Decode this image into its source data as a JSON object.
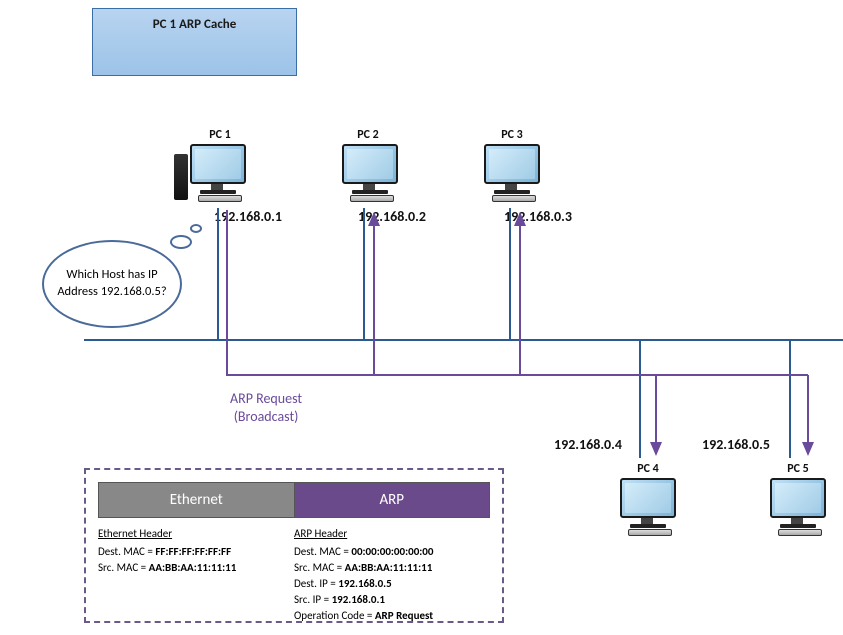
{
  "cache_title": "PC 1  ARP Cache",
  "bubble_text": "Which Host has IP Address 192.168.0.5?",
  "arp_request_label_1": "ARP Request",
  "arp_request_label_2": "(Broadcast)",
  "pcs": {
    "pc1": {
      "label": "PC 1",
      "ip": "192.168.0.1"
    },
    "pc2": {
      "label": "PC 2",
      "ip": "192.168.0.2"
    },
    "pc3": {
      "label": "PC 3",
      "ip": "192.168.0.3"
    },
    "pc4": {
      "label": "PC 4",
      "ip": "192.168.0.4"
    },
    "pc5": {
      "label": "PC 5",
      "ip": "192.168.0.5"
    }
  },
  "packet": {
    "eth_title": "Ethernet",
    "arp_title": "ARP",
    "eth_header_label": "Ethernet Header",
    "eth_dest_mac_label": "Dest. MAC = ",
    "eth_dest_mac": "FF:FF:FF:FF:FF:FF",
    "eth_src_mac_label": "Src. MAC = ",
    "eth_src_mac": "AA:BB:AA:11:11:11",
    "arp_header_label": "ARP Header",
    "arp_dest_mac_label": "Dest. MAC = ",
    "arp_dest_mac": "00:00:00:00:00:00",
    "arp_src_mac_label": "Src. MAC = ",
    "arp_src_mac": "AA:BB:AA:11:11:11",
    "arp_dest_ip_label": "Dest. IP = ",
    "arp_dest_ip": "192.168.0.5",
    "arp_src_ip_label": "Src. IP = ",
    "arp_src_ip": "192.168.0.1",
    "arp_op_label": "Operation Code = ",
    "arp_op": "ARP Request"
  }
}
